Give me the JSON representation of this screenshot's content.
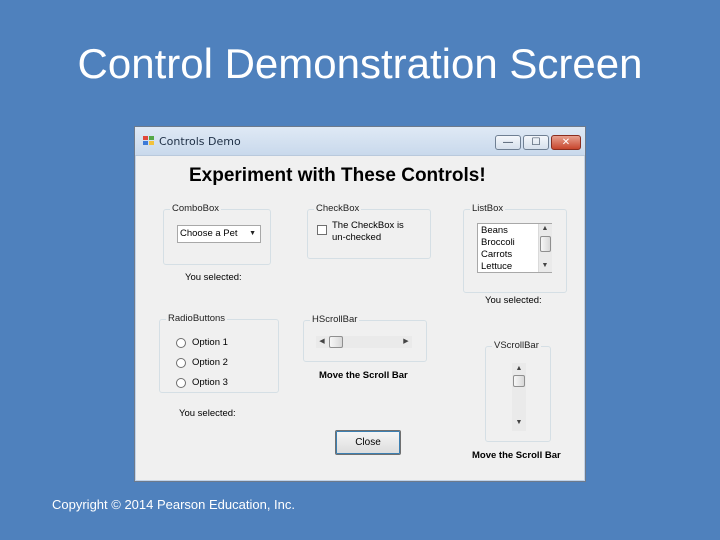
{
  "slide": {
    "title": "Control Demonstration Screen",
    "copyright": "Copyright © 2014 Pearson Education, Inc."
  },
  "window": {
    "title": "Controls Demo",
    "heading": "Experiment with These Controls!",
    "titlebar_buttons": {
      "minimize": "—",
      "maximize": "☐",
      "close": "✕"
    },
    "combobox_group": {
      "label": "ComboBox",
      "selected_value": "Choose a Pet",
      "result_label": "You selected:"
    },
    "checkbox_group": {
      "label": "CheckBox",
      "checkbox_text_line1": "The CheckBox is",
      "checkbox_text_line2": "un-checked",
      "checked": false
    },
    "listbox_group": {
      "label": "ListBox",
      "items": [
        "Beans",
        "Broccoli",
        "Carrots",
        "Lettuce"
      ],
      "result_label": "You selected:"
    },
    "radio_group": {
      "label": "RadioButtons",
      "options": [
        "Option 1",
        "Option 2",
        "Option 3"
      ],
      "result_label": "You selected:"
    },
    "hscroll_group": {
      "label": "HScrollBar",
      "caption": "Move the Scroll Bar",
      "value_fraction": 0.0
    },
    "vscroll_group": {
      "label": "VScrollBar",
      "caption": "Move the Scroll Bar",
      "value_fraction": 0.0
    },
    "close_button": "Close"
  }
}
